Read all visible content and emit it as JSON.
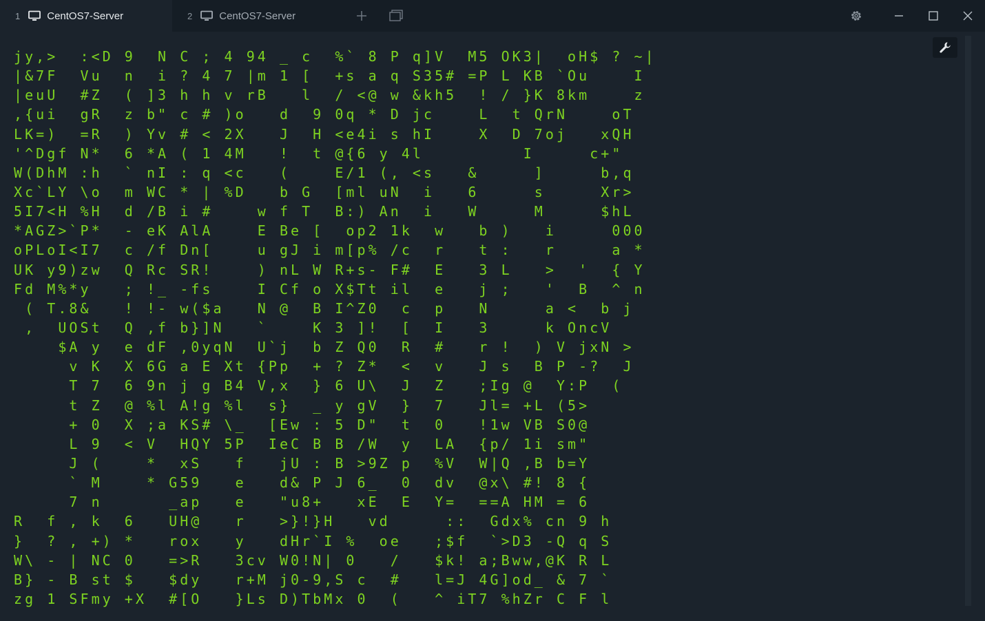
{
  "tabs": [
    {
      "number": "1",
      "title": "CentOS7-Server",
      "active": true
    },
    {
      "number": "2",
      "title": "CentOS7-Server",
      "active": false
    }
  ],
  "toolbar": {
    "new_tab_icon": "plus-icon",
    "tab_overview_icon": "window-stack-icon",
    "settings_icon": "gear-icon",
    "minimize_icon": "minimize-icon",
    "maximize_icon": "maximize-icon",
    "close_icon": "close-icon",
    "terminal_tools_icon": "wrench-icon"
  },
  "colors": {
    "terminal_bg": "#1b232c",
    "tabbar_bg": "#151d25",
    "matrix_green": "#7ed321"
  },
  "terminal": {
    "lines": [
      "jy,>  :<D 9  N C ; 4 94 _ c  %` 8 P q]V  M5 OK3|  oH$ ? ~|",
      "|&7F  Vu  n  i ? 4 7 |m 1 [  +s a q S35# =P L KB `Ou    I",
      "|euU  #Z  ( ]3 h h v rB   l  / <@ w &kh5  ! / }K 8km    z",
      ",{ui  gR  z b\" c # )o   d  9 0q * D jc    L  t QrN    oT",
      "LK=)  =R  ) Yv # < 2X   J  H <e4i s hI    X  D 7oj   xQH",
      "'^Dgf N*  6 *A ( 1 4M   !  t @{6 y 4l         I     c+\"",
      "W(DhM :h  ` nI : q <c   (    E/1 (, <s   &     ]     b,q",
      "Xc`LY \\o  m WC * | %D   b G  [ml uN  i   6     s     Xr>",
      "5I7<H %H  d /B i #    w f T  B:) An  i   W     M     $hL",
      "*AGZ>`P*  - eK AlA    E Be [  op2 1k  w   b )   i     000",
      "oPLoI<I7  c /f Dn[    u gJ i m[p% /c  r   t :   r     a *",
      "UK y9)zw  Q Rc SR!    ) nL W R+s- F#  E   3 L   >  '  { Y",
      "Fd M%*y   ; !_ -fs    I Cf o X$Tt il  e   j ;   '  B  ^ n",
      " ( T.8&   ! !- w($a   N @  B I^Z0  c  p   N     a <  b j",
      " ,  UOSt  Q ,f b}]N   `    K 3 ]!  [  I   3     k OncV",
      "    $A y  e dF ,0yqN  U`j  b Z Q0  R  #   r !  ) V jxN >",
      "     v K  X 6G a E Xt {Pp  + ? Z*  <  v   J s  B P -?  J",
      "     T 7  6 9n j g B4 V,x  } 6 U\\  J  Z   ;Ig @  Y:P  (",
      "     t Z  @ %l A!g %l  s}  _ y gV  }  7   Jl= +L (5>",
      "     + 0  X ;a KS# \\_  [Ew : 5 D\"  t  0   !1w VB S0@",
      "     L 9  < V  HQY 5P  IeC B B /W  y  LA  {p/ 1i sm\"",
      "     J (    *  xS   f   jU : B >9Z p  %V  W|Q ,B b=Y",
      "     ` M    * G59   e   d& P J 6_  0  dv  @x\\ #! 8 {",
      "     7 n      _ap   e   \"u8+   xE  E  Y=  ==A HM = 6",
      "R  f , k  6   UH@   r   >}!}H   vd     ::  Gdx% cn 9 h",
      "}  ? , +) *   rox   y   dHr`I %  oe   ;$f  `>D3 -Q q S",
      "W\\ - | NC 0   =>R   3cv W0!N| 0   /   $k! a;Bww,@K R L",
      "B} - B st $   $dy   r+M j0-9,S c  #   l=J 4G]od_ & 7 `",
      "zg 1 SFmy +X  #[O   }Ls D)TbMx 0  (   ^ iT7 %hZr C F l"
    ]
  }
}
